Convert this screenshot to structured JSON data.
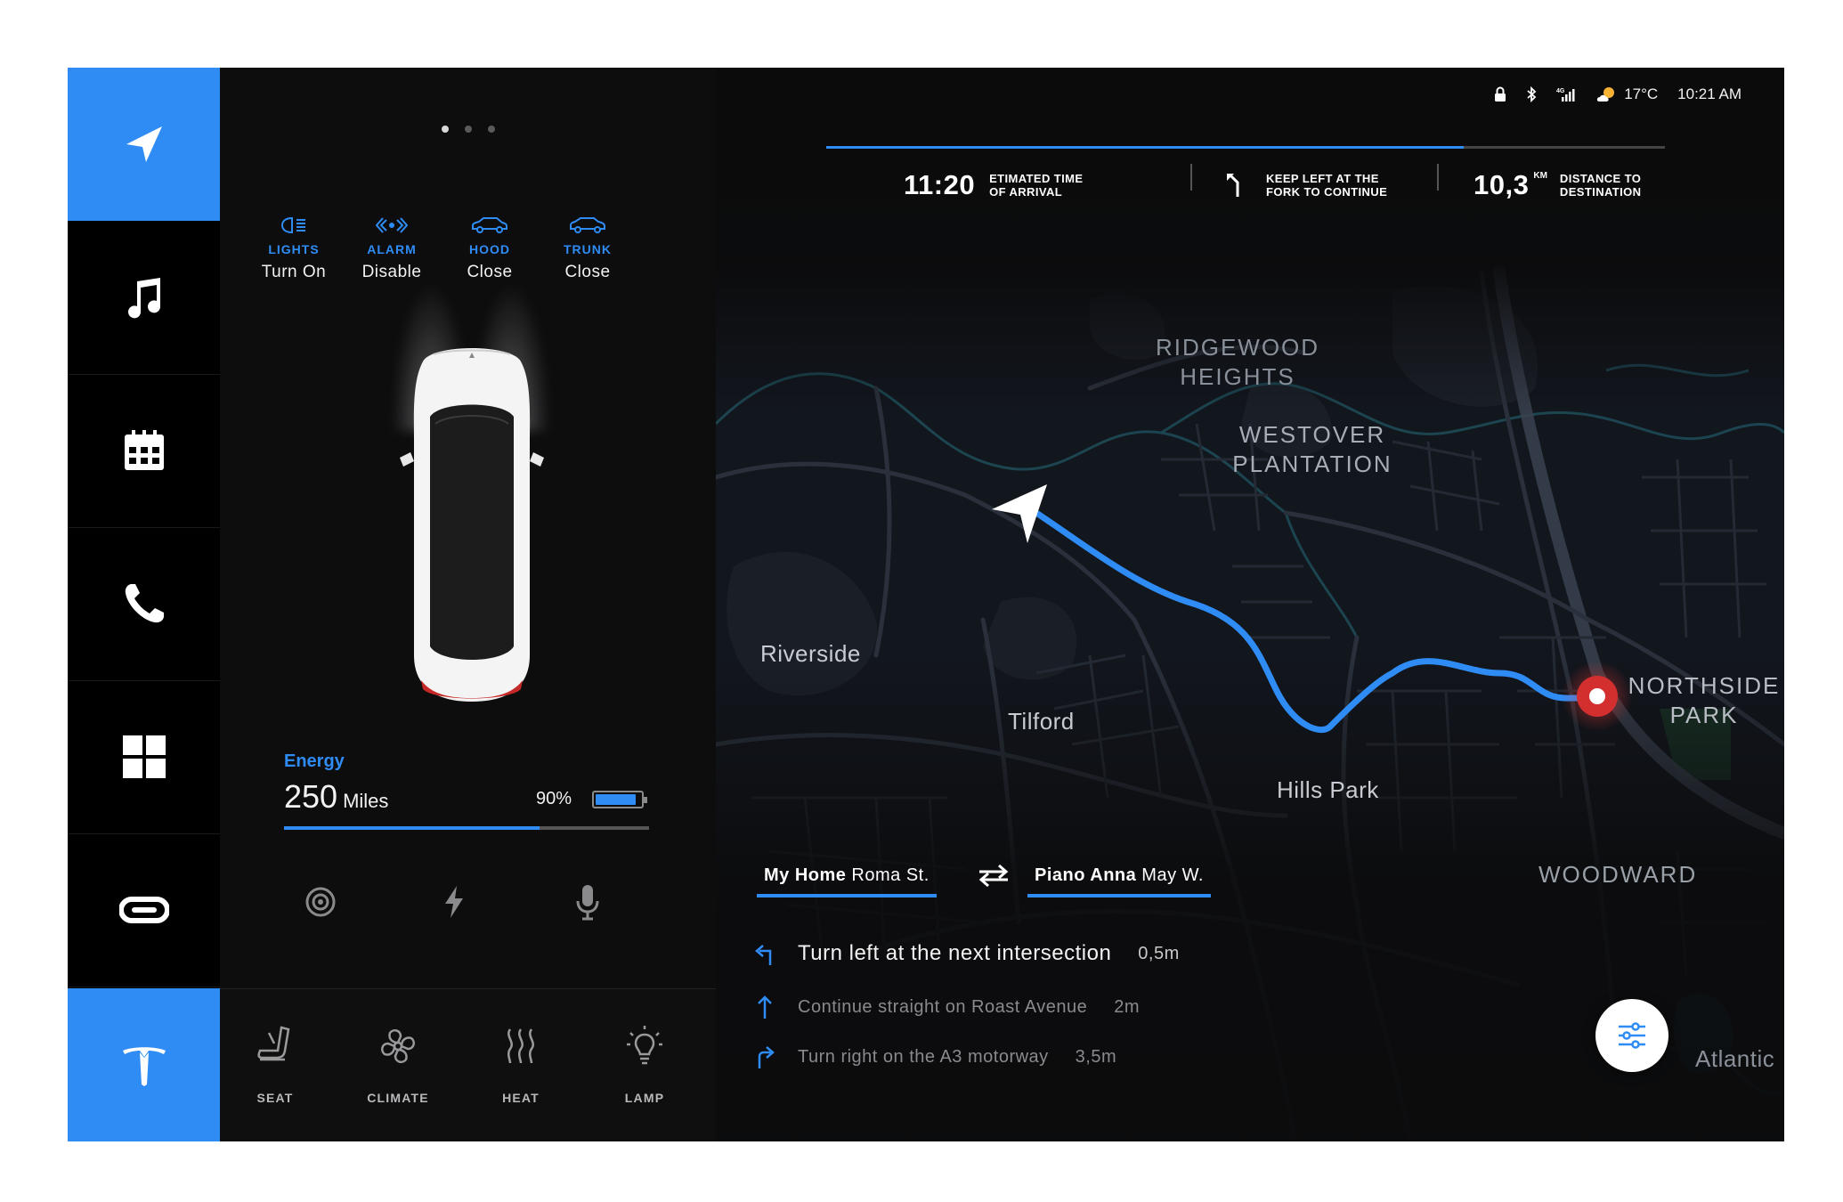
{
  "sidebar": {
    "items": [
      {
        "icon": "navigation-icon",
        "active": true
      },
      {
        "icon": "music-icon",
        "active": false
      },
      {
        "icon": "calendar-icon",
        "active": false
      },
      {
        "icon": "phone-icon",
        "active": false
      },
      {
        "icon": "apps-grid-icon",
        "active": false
      },
      {
        "icon": "vr-headset-icon",
        "active": false
      },
      {
        "icon": "tesla-logo-icon",
        "active": true
      }
    ]
  },
  "vehicle": {
    "page_dots": 3,
    "active_dot": 0,
    "controls": [
      {
        "label": "LIGHTS",
        "value": "Turn On",
        "icon": "lights-icon"
      },
      {
        "label": "ALARM",
        "value": "Disable",
        "icon": "alarm-icon"
      },
      {
        "label": "HOOD",
        "value": "Close",
        "icon": "hood-icon"
      },
      {
        "label": "TRUNK",
        "value": "Close",
        "icon": "trunk-icon"
      }
    ],
    "energy": {
      "label": "Energy",
      "value": "250",
      "unit": "Miles",
      "percent_text": "90%",
      "percent": 90,
      "range_fill": 70
    },
    "quick_icons": [
      "tire-icon",
      "lightning-icon",
      "microphone-icon"
    ]
  },
  "climate": {
    "items": [
      {
        "label": "SEAT",
        "icon": "seat-icon"
      },
      {
        "label": "CLIMATE",
        "icon": "fan-icon"
      },
      {
        "label": "HEAT",
        "icon": "heat-icon"
      },
      {
        "label": "LAMP",
        "icon": "lamp-icon"
      }
    ]
  },
  "status": {
    "icons": [
      "lock-icon",
      "bluetooth-icon",
      "signal-4g-icon",
      "weather-icon"
    ],
    "signal_label": "4G",
    "temperature": "17°C",
    "time": "10:21 AM"
  },
  "nav": {
    "eta_time": "11:20",
    "eta_label_1": "ETIMATED TIME",
    "eta_label_2": "OF ARRIVAL",
    "instruction_1": "KEEP LEFT AT THE",
    "instruction_2": "FORK TO CONTINUE",
    "distance": "10,3",
    "distance_unit": "KM",
    "distance_label_1": "DISTANCE TO",
    "distance_label_2": "DESTINATION",
    "progress": 76
  },
  "map": {
    "labels": {
      "ridgewood_1": "RIDGEWOOD",
      "ridgewood_2": "HEIGHTS",
      "westover_1": "WESTOVER",
      "westover_2": "PLANTATION",
      "riverside": "Riverside",
      "tilford": "Tilford",
      "hills_park": "Hills Park",
      "northside_1": "NORTHSIDE",
      "northside_2": "PARK",
      "woodward": "WOODWARD",
      "atlantic": "Atlantic"
    },
    "route_colors": {
      "route": "#2f8cf5",
      "destination": "#d32f2f"
    }
  },
  "route": {
    "from_bold": "My Home",
    "from_rest": "Roma St.",
    "to_bold": "Piano Anna",
    "to_rest": "May W.",
    "steps": [
      {
        "text": "Turn left at the next intersection",
        "distance": "0,5m",
        "icon": "turn-left-icon"
      },
      {
        "text": "Continue straight on Roast Avenue",
        "distance": "2m",
        "icon": "straight-icon"
      },
      {
        "text": "Turn right on the A3 motorway",
        "distance": "3,5m",
        "icon": "turn-right-icon"
      }
    ]
  },
  "colors": {
    "accent": "#2f8cf5",
    "background": "#0b0b0c"
  }
}
